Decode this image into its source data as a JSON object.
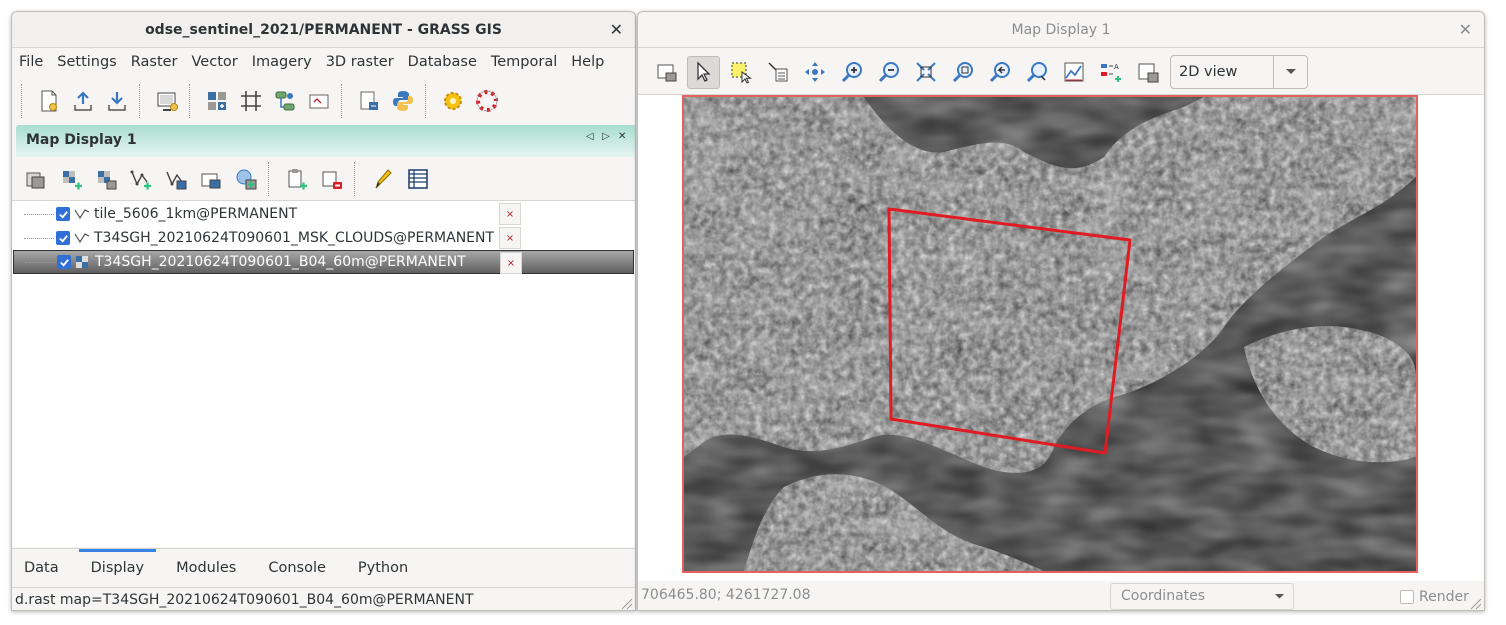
{
  "main_window": {
    "title": "odse_sentinel_2021/PERMANENT - GRASS GIS",
    "close_glyph": "✕",
    "menu": [
      "File",
      "Settings",
      "Raster",
      "Vector",
      "Imagery",
      "3D raster",
      "Database",
      "Temporal",
      "Help"
    ],
    "toolbar_icons": [
      [
        "new-workspace-icon",
        "open-workspace-icon",
        "save-workspace-icon"
      ],
      [
        "new-map-display-icon"
      ],
      [
        "raster-calculator-icon",
        "georectify-icon",
        "graphical-modeler-icon",
        "map-composer-icon"
      ],
      [
        "script-editor-icon",
        "python-icon"
      ],
      [
        "settings-icon",
        "help-icon"
      ]
    ],
    "panel": {
      "title": "Map Display 1",
      "ctl_left": "◁",
      "ctl_right": "▷",
      "ctl_close": "✕"
    },
    "layer_toolbar_icons": [
      "add-map-layers-icon",
      "add-raster-icon",
      "add-raster-misc-icon",
      "add-vector-icon",
      "add-vector-misc-icon",
      "add-overlay-icon",
      "add-web-service-icon",
      "add-group-icon",
      "remove-layer-icon",
      "edit-vector-icon",
      "attribute-table-icon"
    ],
    "layers": [
      {
        "name": "tile_5606_1km@PERMANENT",
        "type": "vector",
        "checked": true,
        "selected": false
      },
      {
        "name": "T34SGH_20210624T090601_MSK_CLOUDS@PERMANENT",
        "type": "vector",
        "checked": true,
        "selected": false
      },
      {
        "name": "T34SGH_20210624T090601_B04_60m@PERMANENT",
        "type": "raster",
        "checked": true,
        "selected": true
      }
    ],
    "bottom_tabs": [
      "Data",
      "Display",
      "Modules",
      "Console",
      "Python"
    ],
    "active_tab": "Display",
    "status_command": "d.rast map=T34SGH_20210624T090601_B04_60m@PERMANENT"
  },
  "map_window": {
    "title": "Map Display 1",
    "close_glyph": "✕",
    "toolbar_icons": [
      "display-map-icon",
      "pointer-icon",
      "select-feature-icon",
      "query-icon",
      "pan-icon",
      "zoom-in-icon",
      "zoom-out-icon",
      "zoom-extent-icon",
      "zoom-region-icon",
      "zoom-back-icon",
      "zoom-menu-icon",
      "analyze-icon",
      "decoration-icon",
      "save-image-icon"
    ],
    "view_mode": "2D view",
    "coordinates": "706465.80; 4261727.08",
    "coord_mode": "Coordinates",
    "render_label": "Render",
    "render_checked": false
  }
}
